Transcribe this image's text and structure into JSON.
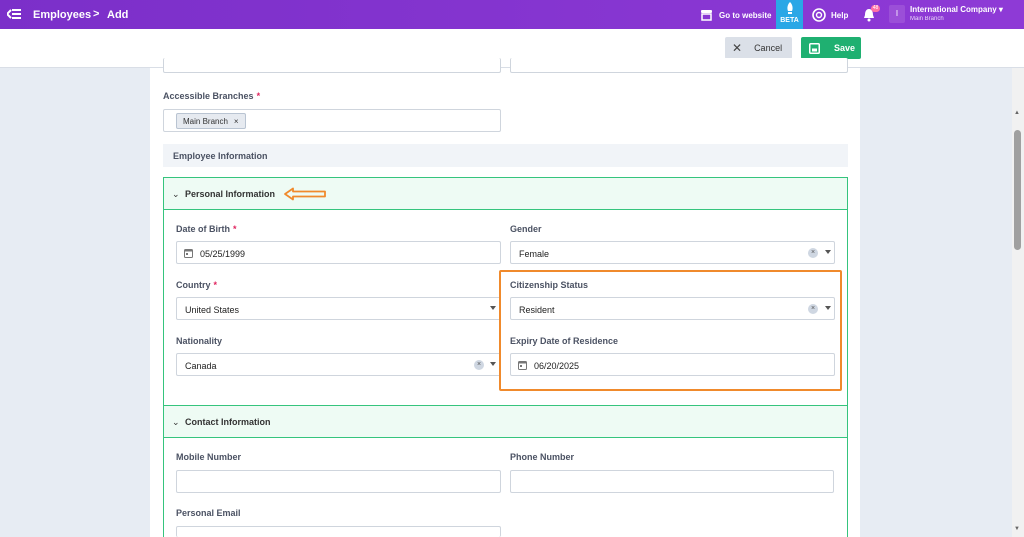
{
  "topbar": {
    "breadcrumb_root": "Employees",
    "breadcrumb_sep": ">",
    "breadcrumb_current": "Add",
    "go_to_website": "Go to website",
    "beta": "BETA",
    "help": "Help",
    "notification_count": "48",
    "avatar_initial": "I",
    "company": "International Company",
    "branch": "Main Branch"
  },
  "actions": {
    "cancel": "Cancel",
    "save": "Save"
  },
  "form": {
    "accessible_branches": {
      "label": "Accessible Branches",
      "required": "*",
      "chip": "Main Branch",
      "chip_remove": "×"
    },
    "employee_information": "Employee Information",
    "personal": {
      "title": "Personal Information",
      "dob": {
        "label": "Date of Birth",
        "required": "*",
        "value": "05/25/1999"
      },
      "gender": {
        "label": "Gender",
        "value": "Female"
      },
      "country": {
        "label": "Country",
        "required": "*",
        "value": "United States"
      },
      "citizenship": {
        "label": "Citizenship Status",
        "value": "Resident"
      },
      "nationality": {
        "label": "Nationality",
        "value": "Canada"
      },
      "expiry": {
        "label": "Expiry Date of Residence",
        "value": "06/20/2025"
      }
    },
    "contact": {
      "title": "Contact Information",
      "mobile": {
        "label": "Mobile Number",
        "value": ""
      },
      "phone": {
        "label": "Phone Number",
        "value": ""
      },
      "email": {
        "label": "Personal Email",
        "value": ""
      }
    }
  },
  "colors": {
    "topbar": "#8e3ad6",
    "save": "#1fb071",
    "panel_border": "#35c47d",
    "highlight": "#f08a2c",
    "beta": "#2aa7e6"
  },
  "icons": {
    "back": "menu-collapse-icon",
    "store": "store-icon",
    "rocket": "rocket-icon",
    "help": "help-circle-icon",
    "bell": "bell-icon",
    "calendar": "calendar-icon",
    "chevron": "chevron-down-icon",
    "save": "floppy-icon",
    "close": "close-icon"
  }
}
